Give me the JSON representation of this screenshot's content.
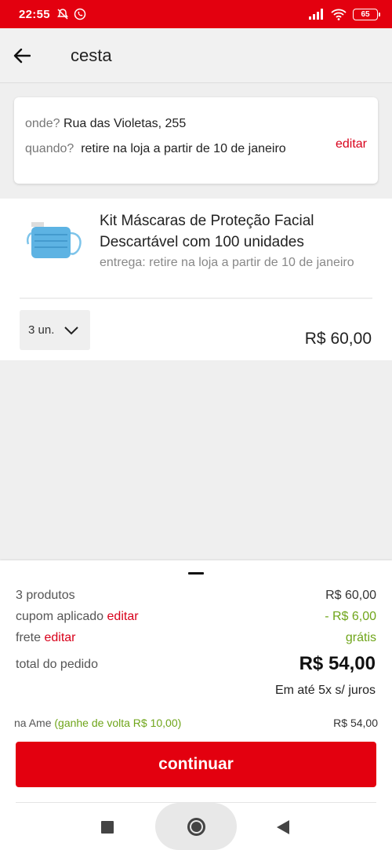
{
  "status_bar": {
    "time": "22:55",
    "battery": "65"
  },
  "header": {
    "title": "cesta"
  },
  "address": {
    "where_label": "onde?",
    "where_value": "Rua das Violetas, 255",
    "when_label": "quando?",
    "when_value": "retire na loja a partir de 10 de janeiro",
    "edit_label": "editar"
  },
  "product": {
    "name": "Kit Máscaras de Proteção Facial Descartável com 100 unidades",
    "delivery": "entrega: retire na loja a partir de 10 de janeiro",
    "quantity": "3 un.",
    "price": "R$ 60,00"
  },
  "summary": {
    "products_label": "3 produtos",
    "products_value": "R$ 60,00",
    "coupon_label": "cupom aplicado",
    "coupon_edit": "editar",
    "coupon_value": "- R$ 6,00",
    "shipping_label": "frete",
    "shipping_edit": "editar",
    "shipping_value": "grátis",
    "total_label": "total do pedido",
    "total_value": "R$ 54,00",
    "installments": "Em até 5x s/ juros",
    "ame_label": "na Ame",
    "ame_cashback": "(ganhe de volta R$ 10,00)",
    "ame_value": "R$ 54,00"
  },
  "actions": {
    "continue_label": "continuar"
  },
  "colors": {
    "brand_red": "#e3000f",
    "success_green": "#6fa51a"
  }
}
